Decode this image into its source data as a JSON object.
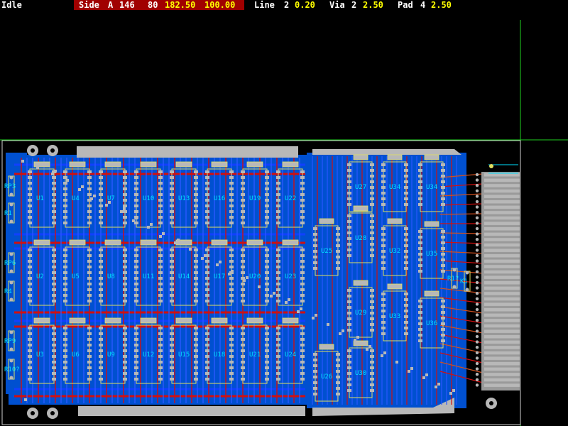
{
  "status": {
    "mode": "Idle",
    "side_label": "Side",
    "side_value": "A",
    "count_a": "146",
    "count_b": "80",
    "coord_x": "182.50",
    "coord_y": "100.00",
    "line_label": "Line",
    "line_num": "2",
    "line_width": "0.20",
    "via_label": "Via",
    "via_num": "2",
    "via_size": "2.50",
    "pad_label": "Pad",
    "pad_num": "4",
    "pad_size": "2.50"
  },
  "colors": {
    "background": "#000000",
    "board_fill": "#0050d0",
    "trace_red": "#d01010",
    "trace_blue": "#1040ff",
    "pad": "#b8b8b8",
    "silk": "#e0e060",
    "cursor": "#20d020",
    "outline": "#d0d0d0",
    "label": "#00e0ff"
  },
  "components": {
    "grid_ics": [
      [
        "U1",
        "U4",
        "U7",
        "U10",
        "U13",
        "U16",
        "U19",
        "U22"
      ],
      [
        "U2",
        "U5",
        "U8",
        "U11",
        "U14",
        "U17",
        "U20",
        "U23"
      ],
      [
        "U3",
        "U6",
        "U9",
        "U12",
        "U15",
        "U18",
        "U21",
        "U24"
      ]
    ],
    "right_ics": [
      "U27",
      "U34",
      "U34",
      "U25",
      "U28",
      "U32",
      "U35",
      "U29",
      "U33",
      "U36",
      "U26",
      "U30"
    ],
    "resistors": [
      "RP3",
      "R1",
      "RP6",
      "R4",
      "RP9",
      "R10?",
      "R1?",
      "K1"
    ]
  }
}
